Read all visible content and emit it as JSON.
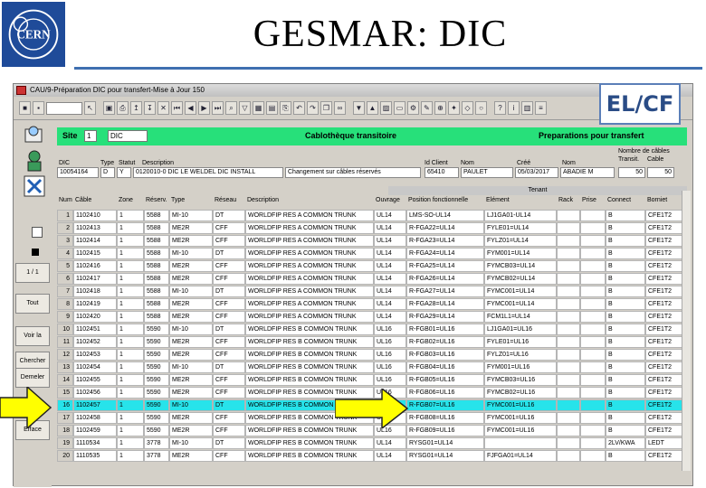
{
  "slide": {
    "title": "GESMAR: DIC",
    "badge": "EL/CF"
  },
  "window": {
    "title": "CAU/9-Préparation DIC pour transfert-Mise à Jour 150"
  },
  "side_buttons": [
    "1 / 1",
    "Tout",
    "Voir la",
    "Chercher",
    "Demeler",
    "Efface"
  ],
  "header": {
    "site_label": "Site",
    "site_value": "1",
    "site_code": "DIC",
    "center": "Cablothèque transitoire",
    "right": "Preparations pour transfert"
  },
  "info": {
    "labels": {
      "dic": "DIC",
      "type": "Type",
      "statut": "Statut",
      "description": "Description",
      "id_client": "Id Client",
      "nom": "Nom",
      "cree": "Créé",
      "nom2": "Nom",
      "nb_cables": "Nombre de câbles",
      "transit": "Transit.",
      "cable": "Cable"
    },
    "values": {
      "dic": "10054164",
      "type": "D",
      "statut": "Y",
      "description": "0120010-0 DIC LE WELDEL DIC INSTALL",
      "description2": "Changement sur câbles réservés",
      "id_client": "65410",
      "nom": "PAULET",
      "cree": "05/03/2017",
      "nom2": "ABADIE M",
      "transit": "50",
      "cable": "50"
    }
  },
  "table": {
    "tenant_label": "Tenant",
    "headers": [
      "Num",
      "Câble",
      "Zone",
      "Réserv.",
      "Type",
      "Réseau",
      "Description",
      "Ouvrage",
      "Position fonctionnelle",
      "Elément",
      "Rack",
      "Prise",
      "Connect",
      "Borniet"
    ],
    "rows": [
      [
        "1",
        "1102410",
        "1",
        "5588",
        "MI-10",
        "DT",
        "WORLDFIP RES A COMMON TRUNK",
        "UL14",
        "LMS-SO-UL14",
        "LJ1GA01-UL14",
        "",
        "",
        "B",
        "CFE1T2"
      ],
      [
        "2",
        "1102413",
        "1",
        "5588",
        "ME2R",
        "CFF",
        "WORLDFIP RES A COMMON TRUNK",
        "UL14",
        "R-FGA22=UL14",
        "FYLE01=UL14",
        "",
        "",
        "B",
        "CFE1T2"
      ],
      [
        "3",
        "1102414",
        "1",
        "5588",
        "ME2R",
        "CFF",
        "WORLDFIP RES A COMMON TRUNK",
        "UL14",
        "R-FGA23=UL14",
        "FYLZ01=UL14",
        "",
        "",
        "B",
        "CFE1T2"
      ],
      [
        "4",
        "1102415",
        "1",
        "5588",
        "MI-10",
        "DT",
        "WORLDFIP RES A COMMON TRUNK",
        "UL14",
        "R-FGA24=UL14",
        "FYM001=UL14",
        "",
        "",
        "B",
        "CFE1T2"
      ],
      [
        "5",
        "1102416",
        "1",
        "5588",
        "ME2R",
        "CFF",
        "WORLDFIP RES A COMMON TRUNK",
        "UL14",
        "R-FGA25=UL14",
        "FYMCB03=UL14",
        "",
        "",
        "B",
        "CFE1T2"
      ],
      [
        "6",
        "1102417",
        "1",
        "5588",
        "ME2R",
        "CFF",
        "WORLDFIP RES A COMMON TRUNK",
        "UL14",
        "R-FGA26=UL14",
        "FYMCB02=UL14",
        "",
        "",
        "B",
        "CFE1T2"
      ],
      [
        "7",
        "1102418",
        "1",
        "5588",
        "MI-10",
        "DT",
        "WORLDFIP RES A COMMON TRUNK",
        "UL14",
        "R-FGA27=UL14",
        "FYMC001=UL14",
        "",
        "",
        "B",
        "CFE1T2"
      ],
      [
        "8",
        "1102419",
        "1",
        "5588",
        "ME2R",
        "CFF",
        "WORLDFIP RES A COMMON TRUNK",
        "UL14",
        "R-FGA28=UL14",
        "FYMC001=UL14",
        "",
        "",
        "B",
        "CFE1T2"
      ],
      [
        "9",
        "1102420",
        "1",
        "5588",
        "ME2R",
        "CFF",
        "WORLDFIP RES A COMMON TRUNK",
        "UL14",
        "R-FGA29=UL14",
        "FCM1L1=UL14",
        "",
        "",
        "B",
        "CFE1T2"
      ],
      [
        "10",
        "1102451",
        "1",
        "5590",
        "MI-10",
        "DT",
        "WORLDFIP RES B COMMON TRUNK",
        "UL16",
        "R-FGB01=UL16",
        "LJ1GA01=UL16",
        "",
        "",
        "B",
        "CFE1T2"
      ],
      [
        "11",
        "1102452",
        "1",
        "5590",
        "ME2R",
        "CFF",
        "WORLDFIP RES B COMMON TRUNK",
        "UL16",
        "R-FGB02=UL16",
        "FYLE01=UL16",
        "",
        "",
        "B",
        "CFE1T2"
      ],
      [
        "12",
        "1102453",
        "1",
        "5590",
        "ME2R",
        "CFF",
        "WORLDFIP RES B COMMON TRUNK",
        "UL16",
        "R-FGB03=UL16",
        "FYLZ01=UL16",
        "",
        "",
        "B",
        "CFE1T2"
      ],
      [
        "13",
        "1102454",
        "1",
        "5590",
        "MI-10",
        "DT",
        "WORLDFIP RES B COMMON TRUNK",
        "UL16",
        "R-FGB04=UL16",
        "FYM001=UL16",
        "",
        "",
        "B",
        "CFE1T2"
      ],
      [
        "14",
        "1102455",
        "1",
        "5590",
        "ME2R",
        "CFF",
        "WORLDFIP RES B COMMON TRUNK",
        "UL16",
        "R-FGB05=UL16",
        "FYMCB03=UL16",
        "",
        "",
        "B",
        "CFE1T2"
      ],
      [
        "15",
        "1102456",
        "1",
        "5590",
        "ME2R",
        "CFF",
        "WORLDFIP RES B COMMON TRUNK",
        "UL16",
        "R-FGB06=UL16",
        "FYMCB02=UL16",
        "",
        "",
        "B",
        "CFE1T2"
      ],
      [
        "16",
        "1102457",
        "1",
        "5590",
        "MI-10",
        "DT",
        "WORLDFIP RES B COMMON TRUNK",
        "UL16",
        "R-FGB07=UL16",
        "FYMC001=UL16",
        "",
        "",
        "B",
        "CFE1T2"
      ],
      [
        "17",
        "1102458",
        "1",
        "5590",
        "ME2R",
        "CFF",
        "WORLDFIP RES B COMMON TRUNK",
        "UL16",
        "R-FGB08=UL16",
        "FYMC001=UL16",
        "",
        "",
        "B",
        "CFE1T2"
      ],
      [
        "18",
        "1102459",
        "1",
        "5590",
        "ME2R",
        "CFF",
        "WORLDFIP RES B COMMON TRUNK",
        "UL16",
        "R-FGB09=UL16",
        "FYMC001=UL16",
        "",
        "",
        "B",
        "CFE1T2"
      ],
      [
        "19",
        "1110534",
        "1",
        "3778",
        "MI-10",
        "DT",
        "WORLDFIP RES B COMMON TRUNK",
        "UL14",
        "RYSG01=UL14",
        "",
        "",
        "",
        "2LV/KWA",
        "LEDT"
      ],
      [
        "20",
        "1110535",
        "1",
        "3778",
        "ME2R",
        "CFF",
        "WORLDFIP RES B COMMON TRUNK",
        "UL14",
        "RYSG01=UL14",
        "FJFGA01=UL14",
        "",
        "",
        "B",
        "CFE1T2"
      ]
    ]
  },
  "colors": {
    "accent_green": "#27e07a",
    "highlight_cyan": "#27e3ea",
    "arrow_yellow": "#ffff00"
  }
}
